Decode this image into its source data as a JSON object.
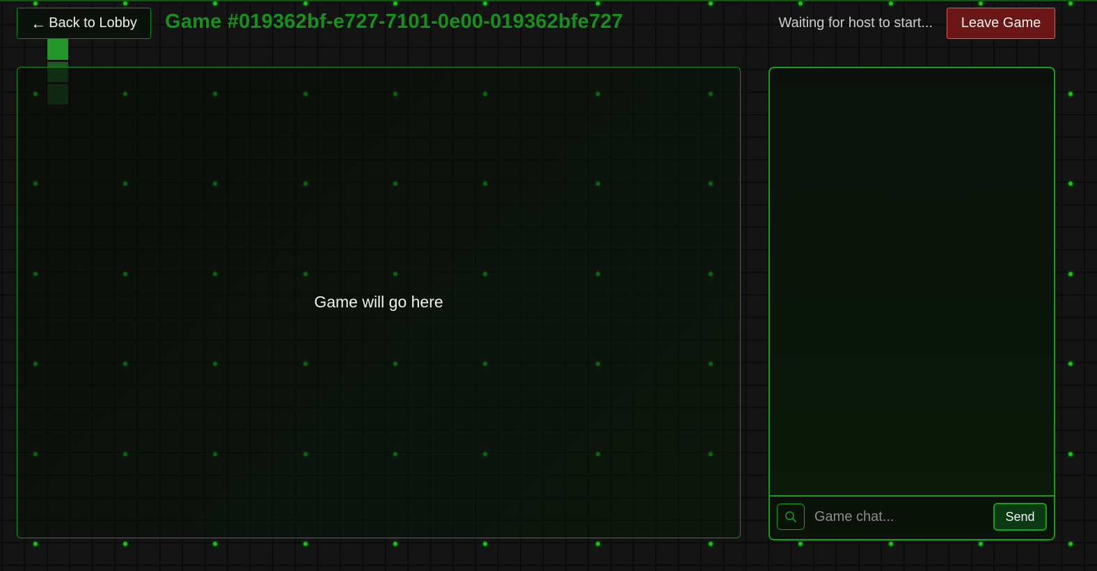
{
  "header": {
    "back_label": "Back to Lobby",
    "back_icon": "left-arrow-icon",
    "title": "Game #019362bf-e727-7101-0e00-019362bfe727",
    "status": "Waiting for host to start...",
    "leave_label": "Leave Game"
  },
  "game": {
    "placeholder": "Game will go here"
  },
  "chat": {
    "input_placeholder": "Game chat...",
    "input_icon": "search-icon",
    "send_label": "Send"
  },
  "colors": {
    "accent_green": "#16a016",
    "title_green": "#14921a",
    "leave_red": "#6b1717",
    "leave_border": "#e06060",
    "background": "#141414"
  }
}
